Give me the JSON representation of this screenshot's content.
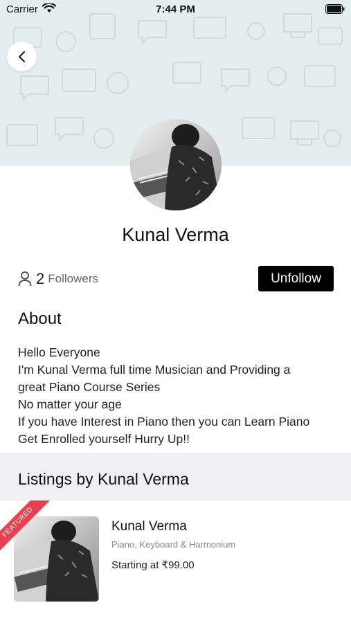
{
  "status_bar": {
    "carrier": "Carrier",
    "time": "7:44 PM"
  },
  "profile": {
    "name": "Kunal Verma",
    "followers_count": "2",
    "followers_label": "Followers",
    "unfollow_label": "Unfollow"
  },
  "about": {
    "heading": "About",
    "lines": [
      "Hello Everyone",
      "I'm Kunal Verma full time Musician and Providing a",
      "great Piano Course Series",
      "No matter your age",
      "If you have Interest in Piano then you can Learn Piano",
      "Get Enrolled yourself Hurry Up!!"
    ]
  },
  "listings": {
    "heading": "Listings by Kunal Verma",
    "items": [
      {
        "badge": "FEATURED",
        "title": "Kunal Verma",
        "category": "Piano, Keyboard & Harmonium",
        "price": "Starting at ₹99.00"
      }
    ]
  },
  "colors": {
    "cover_background": "#e4eef0",
    "featured_ribbon": "#e8404f",
    "button_background": "#000000",
    "section_band": "#f0f0f3"
  },
  "icons": {
    "back": "chevron-left-icon",
    "followers": "person-icon",
    "wifi": "wifi-icon",
    "battery": "battery-icon"
  }
}
